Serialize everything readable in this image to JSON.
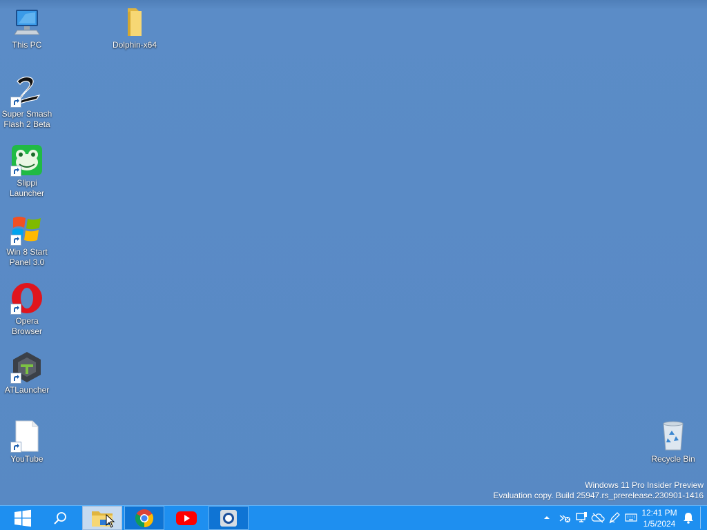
{
  "desktop": {
    "icons": [
      {
        "label": "This PC"
      },
      {
        "label": "Dolphin-x64"
      },
      {
        "label": "Super Smash Flash 2 Beta"
      },
      {
        "label": "Slippi Launcher"
      },
      {
        "label": "Win 8 Start Panel 3.0"
      },
      {
        "label": "Opera Browser"
      },
      {
        "label": "ATLauncher"
      },
      {
        "label": "YouTube"
      },
      {
        "label": "Recycle Bin"
      }
    ]
  },
  "watermark": {
    "line1": "Windows 11 Pro Insider Preview",
    "line2": "Evaluation copy. Build 25947.rs_prerelease.230901-1416"
  },
  "taskbar": {
    "apps": [
      {
        "icon": "file-explorer-icon",
        "state": "active"
      },
      {
        "icon": "chrome-icon",
        "state": "running"
      },
      {
        "icon": "youtube-icon",
        "state": "pinned"
      },
      {
        "icon": "app-circle-icon",
        "state": "running"
      }
    ],
    "clock": {
      "time": "12:41 PM",
      "date": "1/5/2024"
    }
  },
  "colors": {
    "desktop": "#5889c4",
    "taskbar": "#1e8ff0"
  }
}
